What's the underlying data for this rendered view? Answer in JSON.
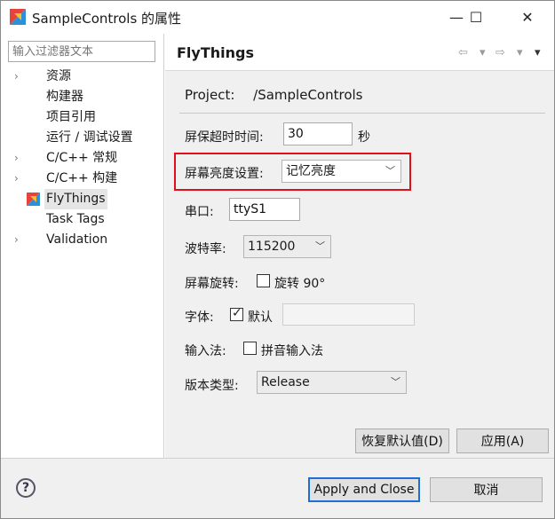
{
  "window": {
    "title": "SampleControls 的属性",
    "controls": {
      "minimize": "—",
      "maximize": "☐",
      "close": "✕"
    }
  },
  "left": {
    "filter_placeholder": "输入过滤器文本",
    "tree": [
      {
        "label": "资源",
        "expandable": true
      },
      {
        "label": "构建器",
        "expandable": false
      },
      {
        "label": "项目引用",
        "expandable": false
      },
      {
        "label": "运行 / 调试设置",
        "expandable": false
      },
      {
        "label": "C/C++ 常规",
        "expandable": true
      },
      {
        "label": "C/C++ 构建",
        "expandable": true
      },
      {
        "label": "FlyThings",
        "expandable": false,
        "selected": true,
        "icon": "flythings-icon"
      },
      {
        "label": "Task Tags",
        "expandable": false
      },
      {
        "label": "Validation",
        "expandable": true
      }
    ]
  },
  "right": {
    "section_title": "FlyThings",
    "project_label": "Project:",
    "project_value": "/SampleControls",
    "screensaver": {
      "label": "屏保超时时间:",
      "value": "30",
      "unit": "秒"
    },
    "brightness": {
      "label": "屏幕亮度设置:",
      "value": "记忆亮度"
    },
    "serial": {
      "label": "串口:",
      "value": "ttyS1"
    },
    "baud": {
      "label": "波特率:",
      "value": "115200"
    },
    "rotation": {
      "label": "屏幕旋转:",
      "checkbox_label": "旋转 90°",
      "checked": false
    },
    "font": {
      "label": "字体:",
      "checkbox_label": "默认",
      "checked": true,
      "value": ""
    },
    "ime": {
      "label": "输入法:",
      "checkbox_label": "拼音输入法",
      "checked": false
    },
    "build_type": {
      "label": "版本类型:",
      "value": "Release"
    },
    "restore_defaults": "恢复默认值(D)",
    "apply": "应用(A)"
  },
  "bottom": {
    "help": "?",
    "apply_close": "Apply and Close",
    "cancel": "取消"
  },
  "colors": {
    "highlight": "#e0101a",
    "primary_border": "#1e6ed3"
  }
}
